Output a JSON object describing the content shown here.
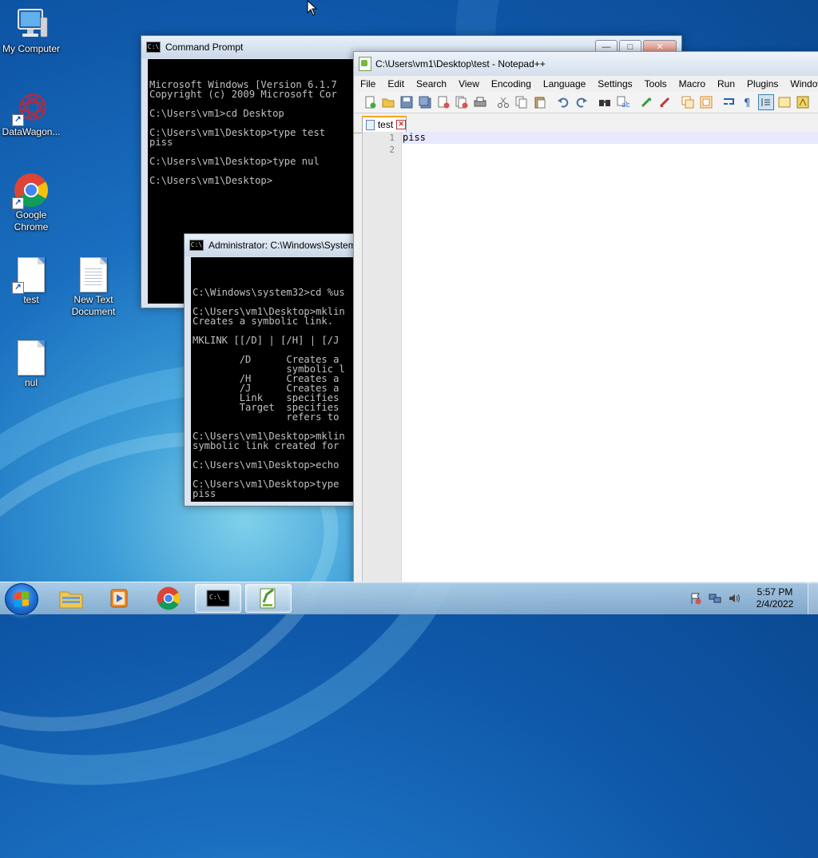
{
  "desktop": {
    "icons": [
      {
        "label": "My Computer"
      },
      {
        "label": "DataWagon..."
      },
      {
        "label": "Google Chrome"
      },
      {
        "label": "test"
      },
      {
        "label": "New Text Document"
      },
      {
        "label": "nul"
      }
    ]
  },
  "cmd1": {
    "title": "Command Prompt",
    "lines": [
      "Microsoft Windows [Version 6.1.7",
      "Copyright (c) 2009 Microsoft Cor",
      "",
      "C:\\Users\\vm1>cd Desktop",
      "",
      "C:\\Users\\vm1\\Desktop>type test",
      "piss",
      "",
      "C:\\Users\\vm1\\Desktop>type nul",
      "",
      "C:\\Users\\vm1\\Desktop>"
    ]
  },
  "cmd2": {
    "title": "Administrator: C:\\Windows\\System",
    "lines": [
      "",
      "C:\\Windows\\system32>cd %us",
      "",
      "C:\\Users\\vm1\\Desktop>mklin",
      "Creates a symbolic link.",
      "",
      "MKLINK [[/D] | [/H] | [/J",
      "",
      "        /D      Creates a",
      "                symbolic l",
      "        /H      Creates a",
      "        /J      Creates a",
      "        Link    specifies",
      "        Target  specifies",
      "                refers to",
      "",
      "C:\\Users\\vm1\\Desktop>mklin",
      "symbolic link created for",
      "",
      "C:\\Users\\vm1\\Desktop>echo",
      "",
      "C:\\Users\\vm1\\Desktop>type",
      "piss",
      "",
      "C:\\Users\\vm1\\Desktop>"
    ]
  },
  "notepadpp": {
    "title": "C:\\Users\\vm1\\Desktop\\test - Notepad++",
    "menu": [
      "File",
      "Edit",
      "Search",
      "View",
      "Encoding",
      "Language",
      "Settings",
      "Tools",
      "Macro",
      "Run",
      "Plugins",
      "Window"
    ],
    "toolbar": [
      "new-icon",
      "open-icon",
      "save-icon",
      "save-all-icon",
      "close-icon",
      "close-all-icon",
      "print-icon",
      "cut-icon",
      "copy-icon",
      "paste-icon",
      "undo-icon",
      "redo-icon",
      "find-icon",
      "replace-icon",
      "zoom-in-icon",
      "zoom-out-icon",
      "sync-v-icon",
      "sync-h-icon",
      "wrap-icon",
      "show-all-icon",
      "indent-guide-icon",
      "doc-map-icon",
      "function-list-icon"
    ],
    "tab": {
      "label": "test"
    },
    "line_numbers": [
      "1",
      "2"
    ],
    "lines": [
      "piss",
      ""
    ]
  },
  "taskbar": {
    "clock_time": "5:57 PM",
    "clock_date": "2/4/2022"
  },
  "colors": {
    "desktop_blue": "#1a6fc0",
    "console_bg": "#000000",
    "console_fg": "#c0c0c0",
    "npp_tab_accent": "#f5a623"
  }
}
